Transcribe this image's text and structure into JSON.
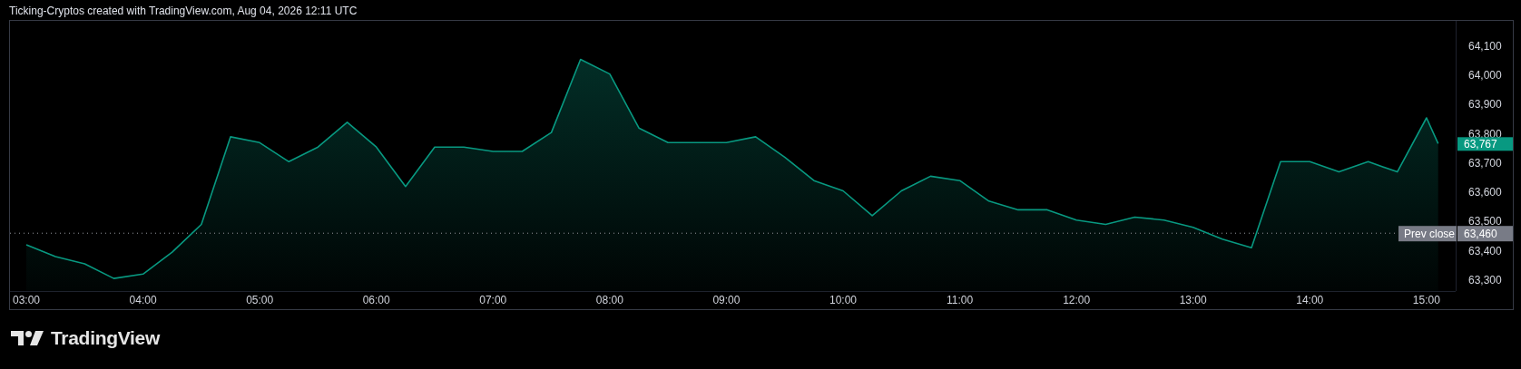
{
  "header": {
    "caption": "Ticking-Cryptos created with TradingView.com, Aug 04, 2026 12:11 UTC"
  },
  "chart": {
    "chart_data": {
      "type": "area",
      "x": [
        3,
        3.25,
        3.5,
        3.75,
        4,
        4.25,
        4.5,
        4.75,
        5,
        5.25,
        5.5,
        5.75,
        6,
        6.25,
        6.5,
        6.75,
        7,
        7.25,
        7.5,
        7.75,
        8,
        8.25,
        8.5,
        8.75,
        9,
        9.25,
        9.5,
        9.75,
        10,
        10.25,
        10.5,
        10.75,
        11,
        11.25,
        11.5,
        11.75,
        12,
        12.25,
        12.5,
        12.75,
        13,
        13.25,
        13.5,
        13.75,
        14,
        14.25,
        14.5,
        14.75,
        15,
        15.1
      ],
      "xlim": [
        2.86,
        15.25
      ],
      "ylim": [
        63262,
        64187
      ],
      "series": [
        {
          "color": "#089981",
          "values": [
            63420,
            63380,
            63355,
            63305,
            63320,
            63395,
            63490,
            63790,
            63770,
            63705,
            63755,
            63840,
            63755,
            63620,
            63755,
            63755,
            63740,
            63740,
            63805,
            64055,
            64005,
            63820,
            63770,
            63770,
            63770,
            63790,
            63720,
            63640,
            63605,
            63520,
            63605,
            63655,
            63640,
            63570,
            63540,
            63540,
            63505,
            63490,
            63515,
            63505,
            63480,
            63440,
            63410,
            63705,
            63705,
            63670,
            63705,
            63670,
            63855,
            63767
          ]
        }
      ],
      "yticks": [
        {
          "value": 64100,
          "label": "64,100"
        },
        {
          "value": 64000,
          "label": "64,000"
        },
        {
          "value": 63900,
          "label": "63,900"
        },
        {
          "value": 63800,
          "label": "63,800"
        },
        {
          "value": 63700,
          "label": "63,700"
        },
        {
          "value": 63600,
          "label": "63,600"
        },
        {
          "value": 63500,
          "label": "63,500"
        },
        {
          "value": 63400,
          "label": "63,400"
        },
        {
          "value": 63300,
          "label": "63,300"
        }
      ],
      "xticks": [
        {
          "value": 3,
          "label": "03:00"
        },
        {
          "value": 4,
          "label": "04:00"
        },
        {
          "value": 5,
          "label": "05:00"
        },
        {
          "value": 6,
          "label": "06:00"
        },
        {
          "value": 7,
          "label": "07:00"
        },
        {
          "value": 8,
          "label": "08:00"
        },
        {
          "value": 9,
          "label": "09:00"
        },
        {
          "value": 10,
          "label": "10:00"
        },
        {
          "value": 11,
          "label": "11:00"
        },
        {
          "value": 12,
          "label": "12:00"
        },
        {
          "value": 13,
          "label": "13:00"
        },
        {
          "value": 14,
          "label": "14:00"
        },
        {
          "value": 15,
          "label": "15:00"
        }
      ],
      "ref_lines": [
        {
          "axis": "y",
          "value": 63460,
          "label": "Prev close"
        }
      ],
      "annotations": [
        {
          "text": "63,767",
          "x": 15.1,
          "y": 63767
        },
        "63,460"
      ]
    }
  },
  "footer": {
    "logo_text": "TradingView"
  }
}
